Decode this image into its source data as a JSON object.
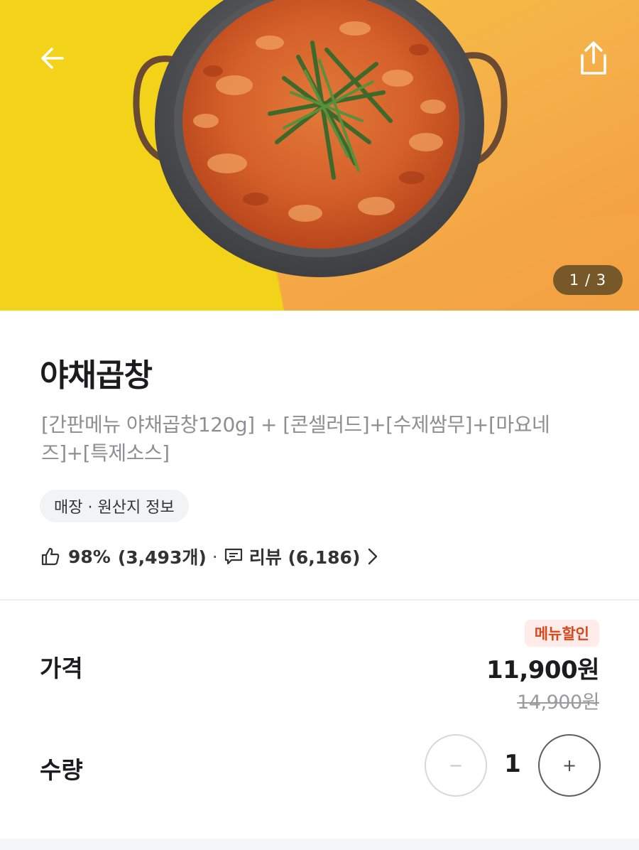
{
  "hero": {
    "image": "stir-fried-gopchang-in-pan-photo",
    "page_indicator": "1 / 3",
    "back_icon": "arrow-left-icon",
    "share_icon": "share-icon"
  },
  "product": {
    "name": "야채곱창",
    "description": "[간판메뉴 야채곱창120g] + [콘셀러드]+[수제쌈무]+[마요네즈]+[특제소스]",
    "info_chip": "매장 · 원산지 정보"
  },
  "rating": {
    "like_percent": "98%",
    "like_count": "(3,493개)",
    "separator": "·",
    "review_label": "리뷰 (6,186)"
  },
  "price": {
    "label": "가격",
    "badge": "메뉴할인",
    "current": "11,900원",
    "original": "14,900원"
  },
  "quantity": {
    "label": "수량",
    "value": "1",
    "minus": "−",
    "plus": "+"
  },
  "colors": {
    "discount_badge_text": "#d9481c",
    "discount_badge_bg": "#fdecea",
    "description_text": "#8e8e93"
  }
}
